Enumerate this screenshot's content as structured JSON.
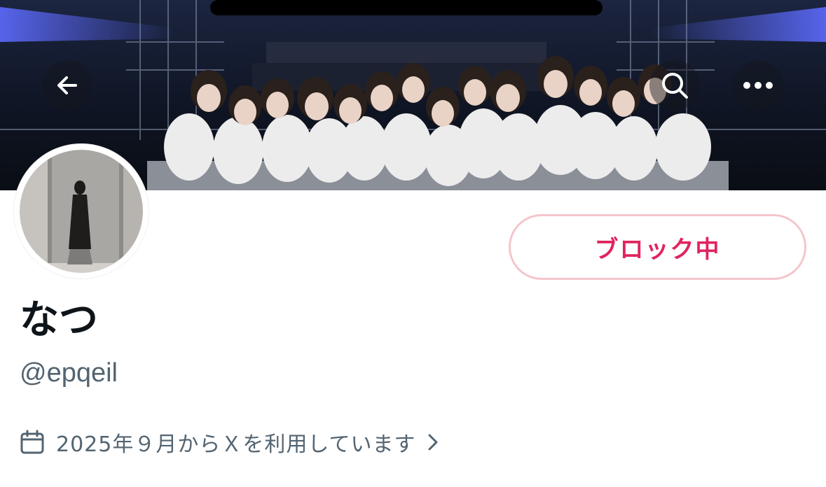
{
  "header": {
    "back_icon": "arrow-left-icon",
    "search_icon": "search-icon",
    "more_icon": "more-horizontal-icon",
    "banner_description_hidden": ""
  },
  "profile": {
    "display_name": "なつ",
    "handle": "@epqeil",
    "joined_text": "2025年９月からＸを利用しています",
    "joined_icon": "calendar-icon",
    "chevron_icon": "chevron-right-icon"
  },
  "actions": {
    "block_label": "ブロック中"
  },
  "colors": {
    "block_text": "#e0245e",
    "block_border": "#f4c6cc",
    "name_text": "#0f1419",
    "secondary_text": "#536471",
    "background": "#ffffff"
  }
}
